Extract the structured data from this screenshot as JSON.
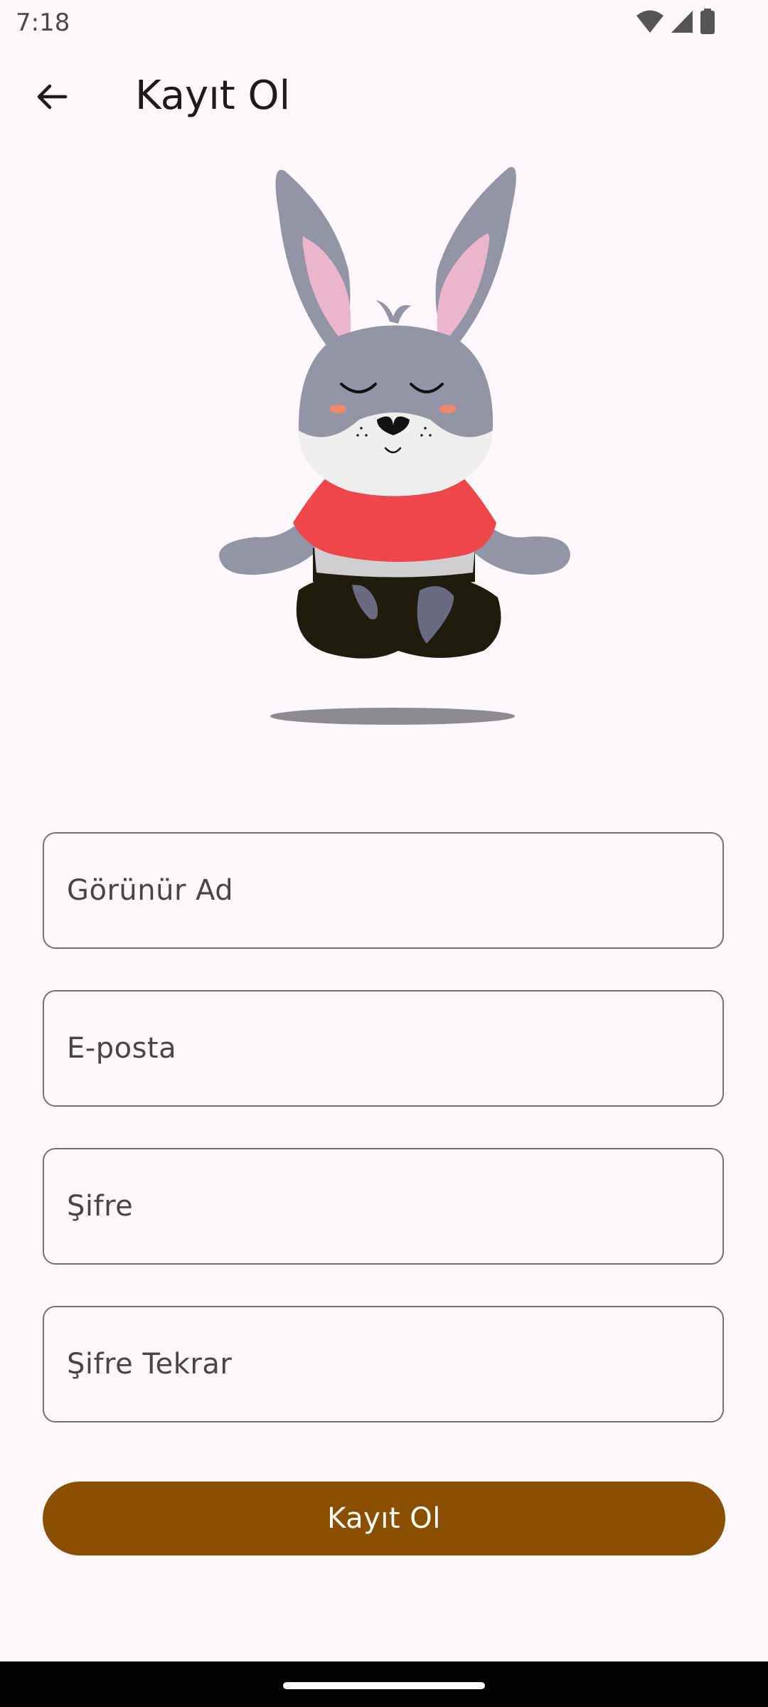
{
  "status_bar": {
    "time": "7:18",
    "icons": [
      "wifi-icon",
      "signal-icon",
      "battery-icon"
    ]
  },
  "app_bar": {
    "back_icon": "arrow-back-icon",
    "title": "Kayıt Ol"
  },
  "illustration": {
    "name": "meditating-rabbit-illustration"
  },
  "form": {
    "display_name_placeholder": "Görünür Ad",
    "email_placeholder": "E-posta",
    "password_placeholder": "Şifre",
    "password_repeat_placeholder": "Şifre Tekrar",
    "submit_label": "Kayıt Ol"
  },
  "colors": {
    "background": "#fef7fb",
    "primary": "#8b4f00",
    "field_border": "#7a7070",
    "text": "#1d1b1e"
  }
}
